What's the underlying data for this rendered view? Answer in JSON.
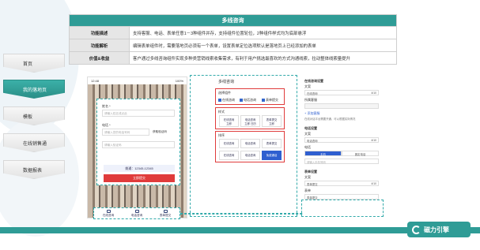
{
  "nav": [
    "首页",
    "我的落地页",
    "模板",
    "在线销售通",
    "数据报表"
  ],
  "active_nav": 1,
  "table": {
    "title": "多线咨询",
    "rows": [
      {
        "key": "功能描述",
        "value": "支持客服、电话、表单任意1－3种组件并存，支持组件位置轮位，2种组件样式均为底部悬浮"
      },
      {
        "key": "功能解析",
        "value": "编辑表单组件时，需要落地页必须有一个表单，设置表单定位选项默认是落地页上已经添加的表单"
      },
      {
        "key": "价值&收益",
        "value": "客户通过多线咨询组件实现多种类营销线索收集需求，有利于用户挑选最喜欢的方式沟通线索，拉动整体线索量提升"
      }
    ]
  },
  "phone": {
    "time": "12:48",
    "battery": "100%",
    "f1_label": "姓名 *",
    "f1_ph": "请输入姓名或点此",
    "f2_label": "电话 *",
    "f2_ph": "请输入您的电话号码",
    "code_btn": "获取验证码",
    "code_ph": "请输入验证码",
    "phone_btn": "拨通：12345-12345",
    "submit": "立即提交",
    "bottom": [
      "在线咨询",
      "电话咨询",
      "表单提交"
    ]
  },
  "panel": {
    "title": "多线咨询",
    "sec1": "选择组件",
    "checks": [
      "在线咨询",
      "电话咨询",
      "表单提交"
    ],
    "sec2": "样式",
    "styles": [
      [
        "在线咨询",
        "立即"
      ],
      [
        "电话咨询",
        "立即 日历"
      ],
      [
        "表单提交",
        "立即"
      ]
    ],
    "sec3": "排序",
    "sort_top": [
      "在线咨询",
      "电话咨询",
      "表单提交"
    ],
    "sort_bot": [
      "在线咨询",
      "电话咨询",
      "免费通话"
    ]
  },
  "right": {
    "h1": "在线咨询设置",
    "l1": "文案",
    "v1": "在线咨询",
    "n1": "4/10",
    "l2": "所属客服",
    "add": "+ 添加客服",
    "note": "在线对话平台需要开通，可以根据实际情况",
    "h2": "电话设置",
    "l3": "文案",
    "v3": "电话咨询",
    "n3": "4/10",
    "l4": "电话",
    "tab_a": "手机",
    "tab_b": "固定电话",
    "ph4": "请输入手机号码",
    "h3": "表单设置",
    "l5": "文案",
    "v5": "表单提交",
    "n5": "4/10",
    "l6": "表单",
    "v6": "表单提交"
  },
  "brand": "磁力引擎"
}
